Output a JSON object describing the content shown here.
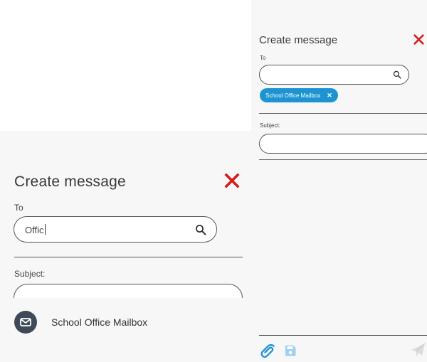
{
  "left_panel": {
    "title": "Create message",
    "to_label": "To",
    "to_value": "Offic",
    "subject_label": "Subject:",
    "suggestions": [
      {
        "name": "School Office Mailbox",
        "icon": "envelope-icon"
      }
    ]
  },
  "right_panel": {
    "title": "Create message",
    "to_label": "To",
    "recipients": [
      {
        "label": "School Office Mailbox"
      }
    ],
    "subject_label": "Subject:",
    "toolbar": {
      "attach_icon": "paperclip-icon",
      "save_icon": "save-disk-icon",
      "send_icon": "paper-plane-icon"
    }
  },
  "colors": {
    "close": "#d51b1b",
    "chip": "#1d93d2",
    "attach": "#1d93d2",
    "save": "#9fd0ee",
    "send": "#dcdcdc",
    "avatar": "#3f4a58"
  }
}
